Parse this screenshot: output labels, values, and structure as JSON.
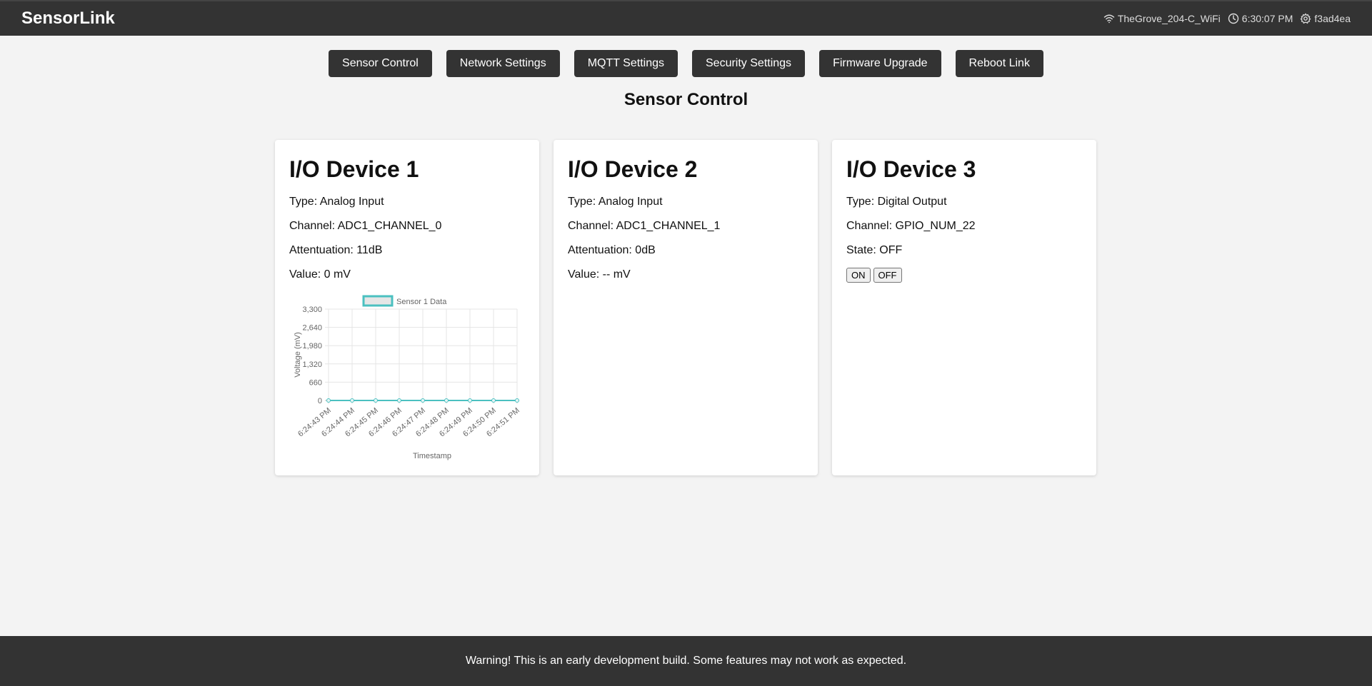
{
  "app": {
    "title": "SensorLink"
  },
  "status": {
    "wifi": "TheGrove_204-C_WiFi",
    "time": "6:30:07 PM",
    "device_id": "f3ad4ea"
  },
  "nav": [
    {
      "label": "Sensor Control"
    },
    {
      "label": "Network Settings"
    },
    {
      "label": "MQTT Settings"
    },
    {
      "label": "Security Settings"
    },
    {
      "label": "Firmware Upgrade"
    },
    {
      "label": "Reboot Link"
    }
  ],
  "page": {
    "title": "Sensor Control"
  },
  "devices": [
    {
      "title": "I/O Device 1",
      "type": "Type: Analog Input",
      "channel": "Channel: ADC1_CHANNEL_0",
      "attenuation": "Attentuation: 11dB",
      "value": "Value: 0 mV"
    },
    {
      "title": "I/O Device 2",
      "type": "Type: Analog Input",
      "channel": "Channel: ADC1_CHANNEL_1",
      "attenuation": "Attentuation: 0dB",
      "value": "Value: -- mV"
    },
    {
      "title": "I/O Device 3",
      "type": "Type: Digital Output",
      "channel": "Channel: GPIO_NUM_22",
      "state": "State: OFF",
      "on_label": "ON",
      "off_label": "OFF"
    }
  ],
  "chart_data": {
    "type": "line",
    "series": [
      {
        "name": "Sensor 1 Data",
        "values": [
          0,
          0,
          0,
          0,
          0,
          0,
          0,
          0,
          0
        ]
      }
    ],
    "x": [
      "6:24:43 PM",
      "6:24:44 PM",
      "6:24:45 PM",
      "6:24:46 PM",
      "6:24:47 PM",
      "6:24:48 PM",
      "6:24:49 PM",
      "6:24:50 PM",
      "6:24:51 PM"
    ],
    "xlabel": "Timestamp",
    "ylabel": "Voltage (mV)",
    "ylim": [
      0,
      3300
    ],
    "yticks": [
      "3,300",
      "2,640",
      "1,980",
      "1,320",
      "660",
      "0"
    ],
    "yticks_values": [
      3300,
      2640,
      1980,
      1320,
      660,
      0
    ],
    "grid": true,
    "legend": "top",
    "color": "#4bc0c0"
  },
  "footer": {
    "text": "Warning! This is an early development build. Some features may not work as expected."
  }
}
